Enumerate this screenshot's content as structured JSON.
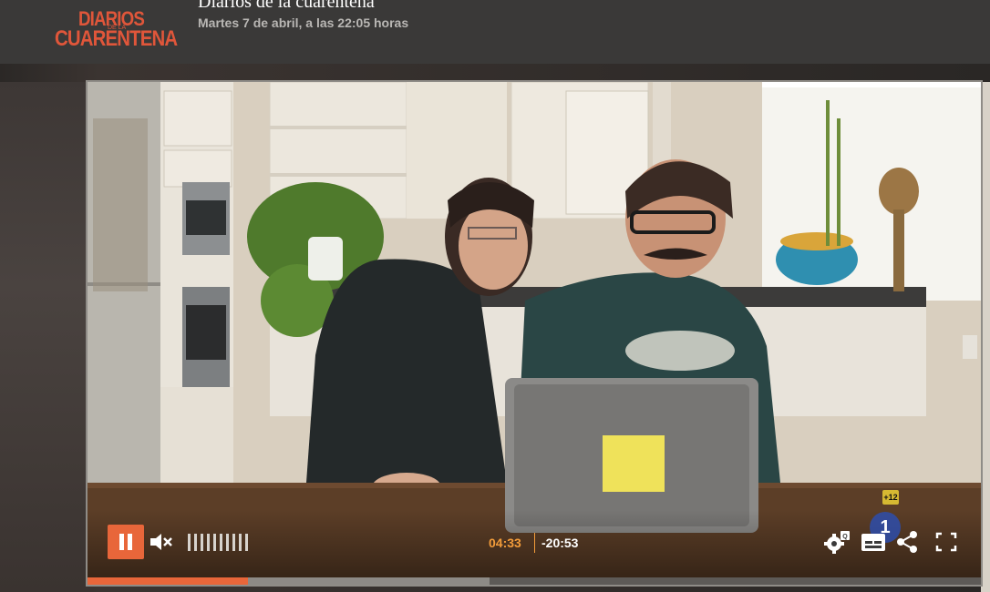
{
  "header": {
    "logo": {
      "line1": "DIARIOS",
      "line_mid": "DE LA",
      "line2": "CUARENTENA"
    },
    "title": "Diarios de la cuarentena",
    "subtitle": "Martes 7 de abril, a las 22:05 horas"
  },
  "player": {
    "state": "playing",
    "pause_icon": "pause-icon",
    "mute_icon": "muted-speaker-icon",
    "volume_bars": 10,
    "current_time": "04:33",
    "remaining_time": "-20:53",
    "progress_fraction": 0.18,
    "buffered_fraction": 0.45,
    "controls": [
      {
        "name": "settings-icon"
      },
      {
        "name": "subtitles-icon"
      },
      {
        "name": "share-icon"
      },
      {
        "name": "fullscreen-icon"
      }
    ],
    "overlay": {
      "rating": "+12",
      "channel": "1"
    },
    "accent_color": "#e8663a",
    "time_color": "#f39c3a"
  }
}
